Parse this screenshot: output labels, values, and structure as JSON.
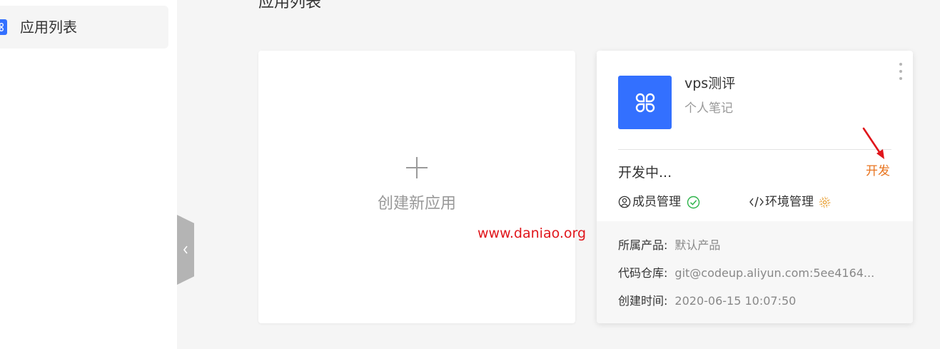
{
  "sidebar": {
    "items": [
      {
        "label": "应用列表",
        "icon": "app-grid-icon",
        "active": true
      }
    ]
  },
  "page": {
    "title": "应用列表"
  },
  "new_app_card": {
    "label": "创建新应用",
    "icon": "plus-icon"
  },
  "app_card": {
    "name": "vps测评",
    "description": "个人笔记",
    "icon": "app-grid-icon",
    "status": "开发中...",
    "dev_action": "开发",
    "member_mgmt": {
      "label": "成员管理",
      "icon": "user-circle-icon",
      "status_icon": "check-circle-icon"
    },
    "env_mgmt": {
      "label": "环境管理",
      "icon": "code-icon",
      "status_icon": "gear-icon"
    },
    "info": [
      {
        "key": "所属产品:",
        "value": "默认产品"
      },
      {
        "key": "代码仓库:",
        "value": "git@codeup.aliyun.com:5ee4164..."
      },
      {
        "key": "创建时间:",
        "value": "2020-06-15 10:07:50"
      }
    ]
  },
  "watermark": "www.daniao.org",
  "colors": {
    "accent": "#3370ff",
    "dev_link": "#e8741f",
    "success": "#2db34a",
    "annotation": "#e0151b"
  }
}
